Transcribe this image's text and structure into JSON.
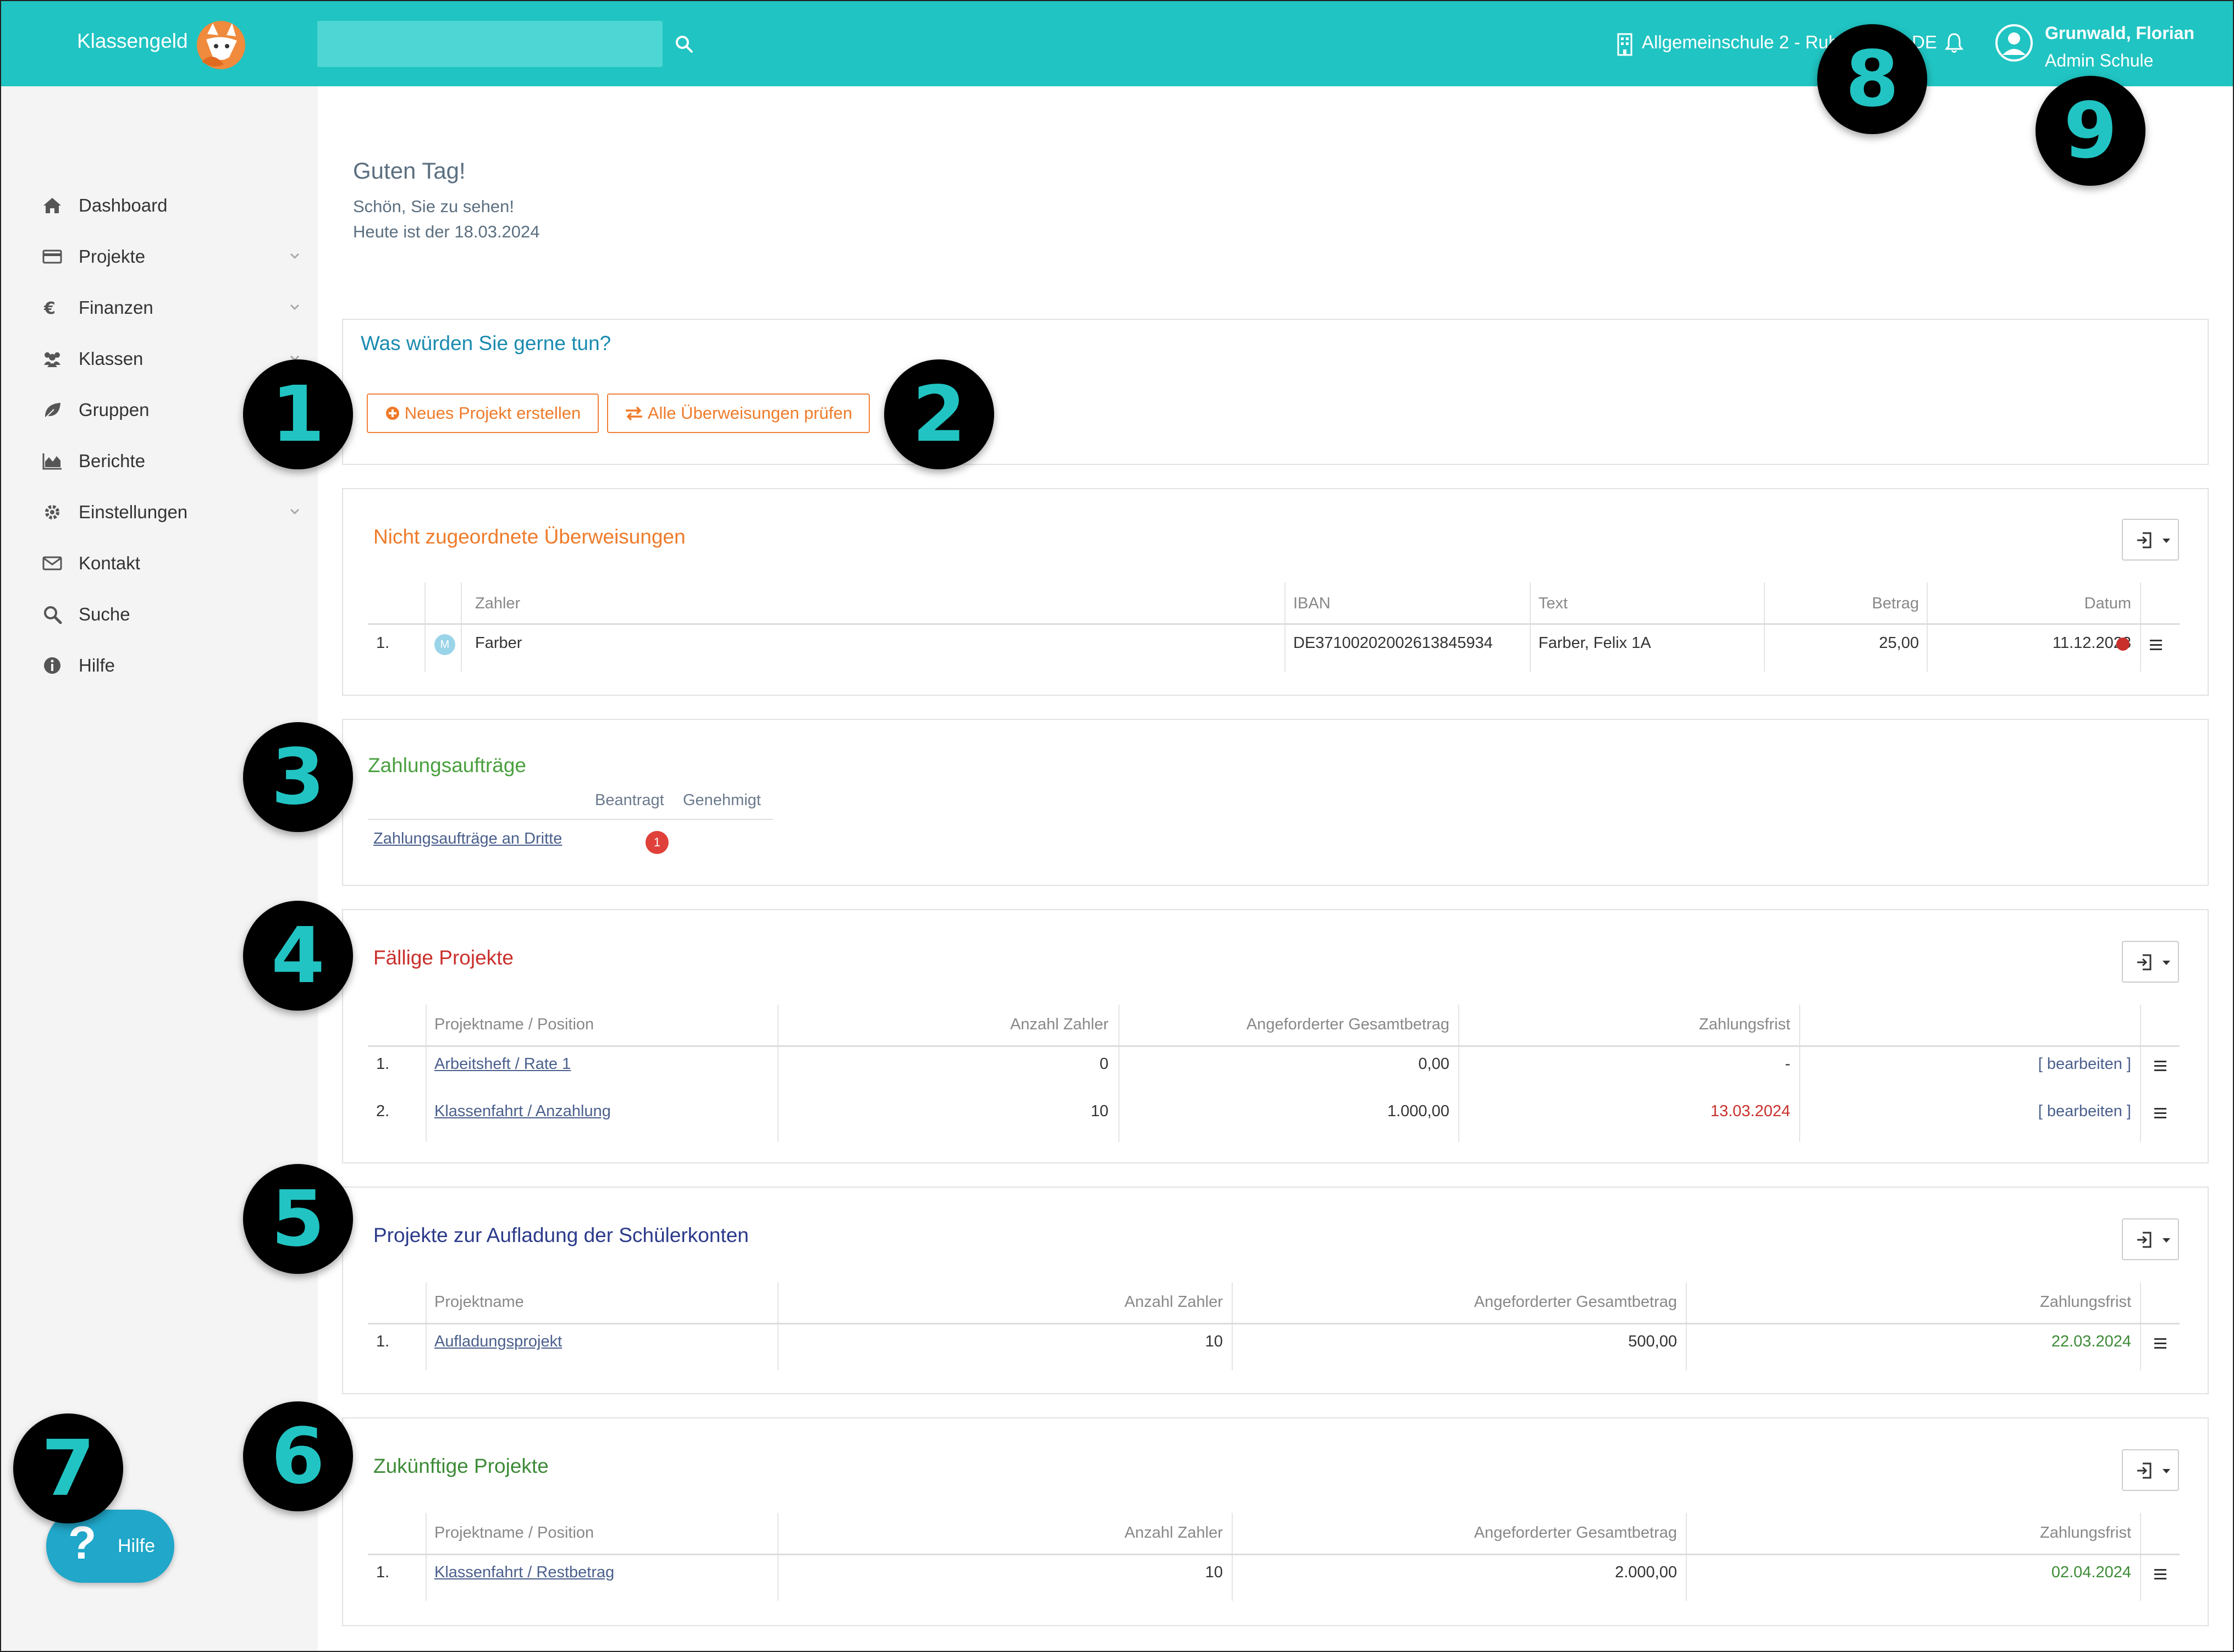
{
  "header": {
    "brand": "Klassengeld",
    "search_placeholder": "",
    "school": "Allgemeinschule 2 - Ruhr",
    "language": "DE",
    "user_name": "Grunwald, Florian",
    "user_role": "Admin Schule"
  },
  "sidebar": {
    "items": [
      {
        "label": "Dashboard",
        "icon": "home-icon"
      },
      {
        "label": "Projekte",
        "icon": "credit-card-icon",
        "expandable": true
      },
      {
        "label": "Finanzen",
        "icon": "euro-icon",
        "expandable": true
      },
      {
        "label": "Klassen",
        "icon": "users-icon",
        "expandable": true
      },
      {
        "label": "Gruppen",
        "icon": "leaf-icon"
      },
      {
        "label": "Berichte",
        "icon": "area-chart-icon"
      },
      {
        "label": "Einstellungen",
        "icon": "gear-icon",
        "expandable": true
      },
      {
        "label": "Kontakt",
        "icon": "envelope-icon"
      },
      {
        "label": "Suche",
        "icon": "search-icon"
      },
      {
        "label": "Hilfe",
        "icon": "info-icon"
      }
    ],
    "help_button": "Hilfe",
    "help_glyph": "?"
  },
  "greeting": {
    "title": "Guten Tag!",
    "subtitle": "Schön, Sie zu sehen!",
    "date_line": "Heute ist der 18.03.2024"
  },
  "actions": {
    "title": "Was würden Sie gerne tun?",
    "new_project": "Neues Projekt erstellen",
    "check_transfers": "Alle Überweisungen prüfen"
  },
  "unassigned": {
    "title": "Nicht zugeordnete Überweisungen",
    "columns": [
      "Zahler",
      "IBAN",
      "Text",
      "Betrag",
      "Datum"
    ],
    "rows": [
      {
        "num": "1.",
        "avatar": "M",
        "payer": "Farber",
        "iban": "DE37100202002613845934",
        "text": "Farber, Felix 1A",
        "amount": "25,00",
        "date": "11.12.2023"
      }
    ]
  },
  "payment_orders": {
    "title": "Zahlungsaufträge",
    "col_requested": "Beantragt",
    "col_approved": "Genehmigt",
    "row_label": "Zahlungsaufträge an Dritte",
    "row_count": "1"
  },
  "due_projects": {
    "title": "Fällige Projekte",
    "columns": [
      "Projektname / Position",
      "Anzahl Zahler",
      "Angeforderter Gesamtbetrag",
      "Zahlungsfrist"
    ],
    "edit_label": "[ bearbeiten ]",
    "rows": [
      {
        "num": "1.",
        "name": "Arbeitsheft / Rate 1",
        "payers": "0",
        "total": "0,00",
        "deadline": "-"
      },
      {
        "num": "2.",
        "name": "Klassenfahrt / Anzahlung",
        "payers": "10",
        "total": "1.000,00",
        "deadline": "13.03.2024"
      }
    ]
  },
  "topup_projects": {
    "title": "Projekte zur Aufladung der Schülerkonten",
    "columns": [
      "Projektname",
      "Anzahl Zahler",
      "Angeforderter Gesamtbetrag",
      "Zahlungsfrist"
    ],
    "rows": [
      {
        "num": "1.",
        "name": "Aufladungsprojekt",
        "payers": "10",
        "total": "500,00",
        "deadline": "22.03.2024"
      }
    ]
  },
  "future_projects": {
    "title": "Zukünftige Projekte",
    "columns": [
      "Projektname / Position",
      "Anzahl Zahler",
      "Angeforderter Gesamtbetrag",
      "Zahlungsfrist"
    ],
    "rows": [
      {
        "num": "1.",
        "name": "Klassenfahrt / Restbetrag",
        "payers": "10",
        "total": "2.000,00",
        "deadline": "02.04.2024"
      }
    ]
  },
  "callouts": [
    "1",
    "2",
    "3",
    "4",
    "5",
    "6",
    "7",
    "8",
    "9"
  ],
  "colors": {
    "topbar": "#20c4c2",
    "accent_orange": "#ef7b2a",
    "due_red": "#c9302c",
    "future_green": "#3d8b37",
    "topup_navy": "#2b3a8a",
    "payment_green": "#4aa03f",
    "link_blue": "#1a8bb0"
  }
}
